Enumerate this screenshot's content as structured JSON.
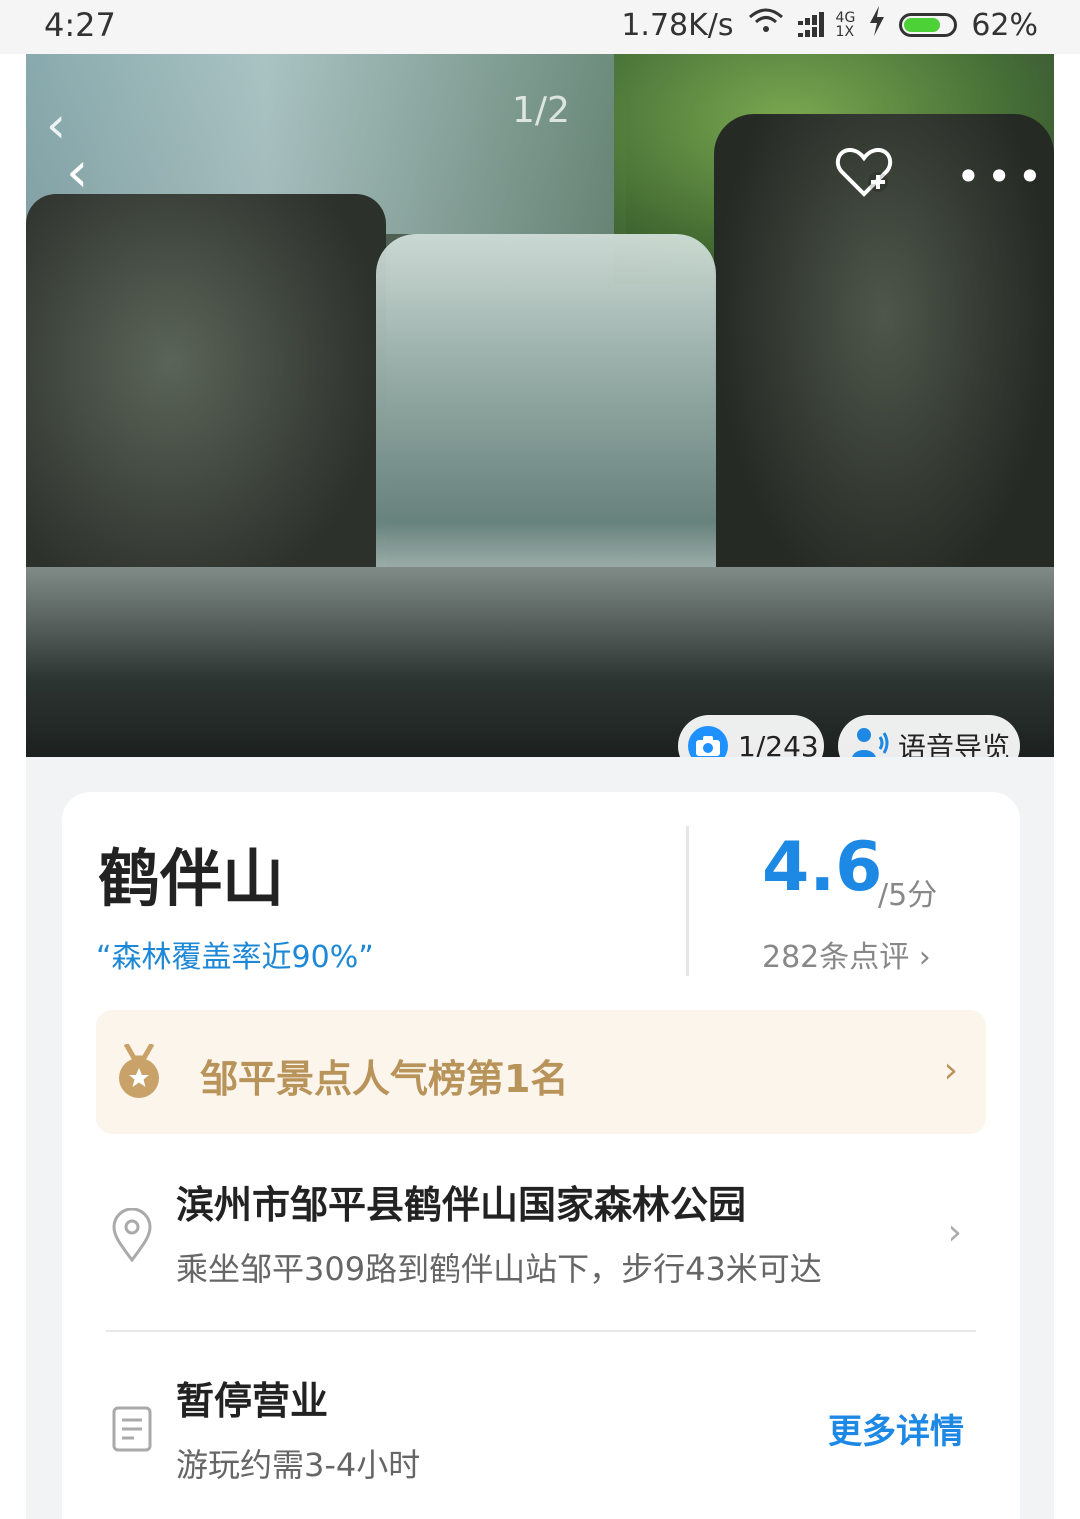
{
  "status_bar": {
    "time": "4:27",
    "net_speed": "1.78K/s",
    "network_top": "4G",
    "network_bottom": "1X",
    "battery": "62%"
  },
  "hero": {
    "image_counter": "1/2",
    "photos_count": "1/243",
    "audio_guide": "语音导览"
  },
  "attraction": {
    "name": "鹤伴山",
    "tagline": "“森林覆盖率近90%”",
    "rating": "4.6",
    "rating_unit": "/5分",
    "reviews": "282条点评 ›",
    "rank_label": "邹平景点人气榜第1名",
    "address": "滨州市邹平县鹤伴山国家森林公园",
    "directions": "乘坐邹平309路到鹤伴山站下，步行43米可达",
    "status": "暂停营业",
    "duration": "游玩约需3-4小时",
    "more_details": "更多详情"
  },
  "colors": {
    "accent": "#1e88e5",
    "rank_text": "#b8935a",
    "rank_bg": "#fbf5ec"
  },
  "icons": [
    "back-icon",
    "favorite-add-icon",
    "more-icon",
    "camera-icon",
    "audio-guide-icon",
    "medal-icon",
    "location-pin-icon",
    "document-icon",
    "chevron-right-icon"
  ]
}
